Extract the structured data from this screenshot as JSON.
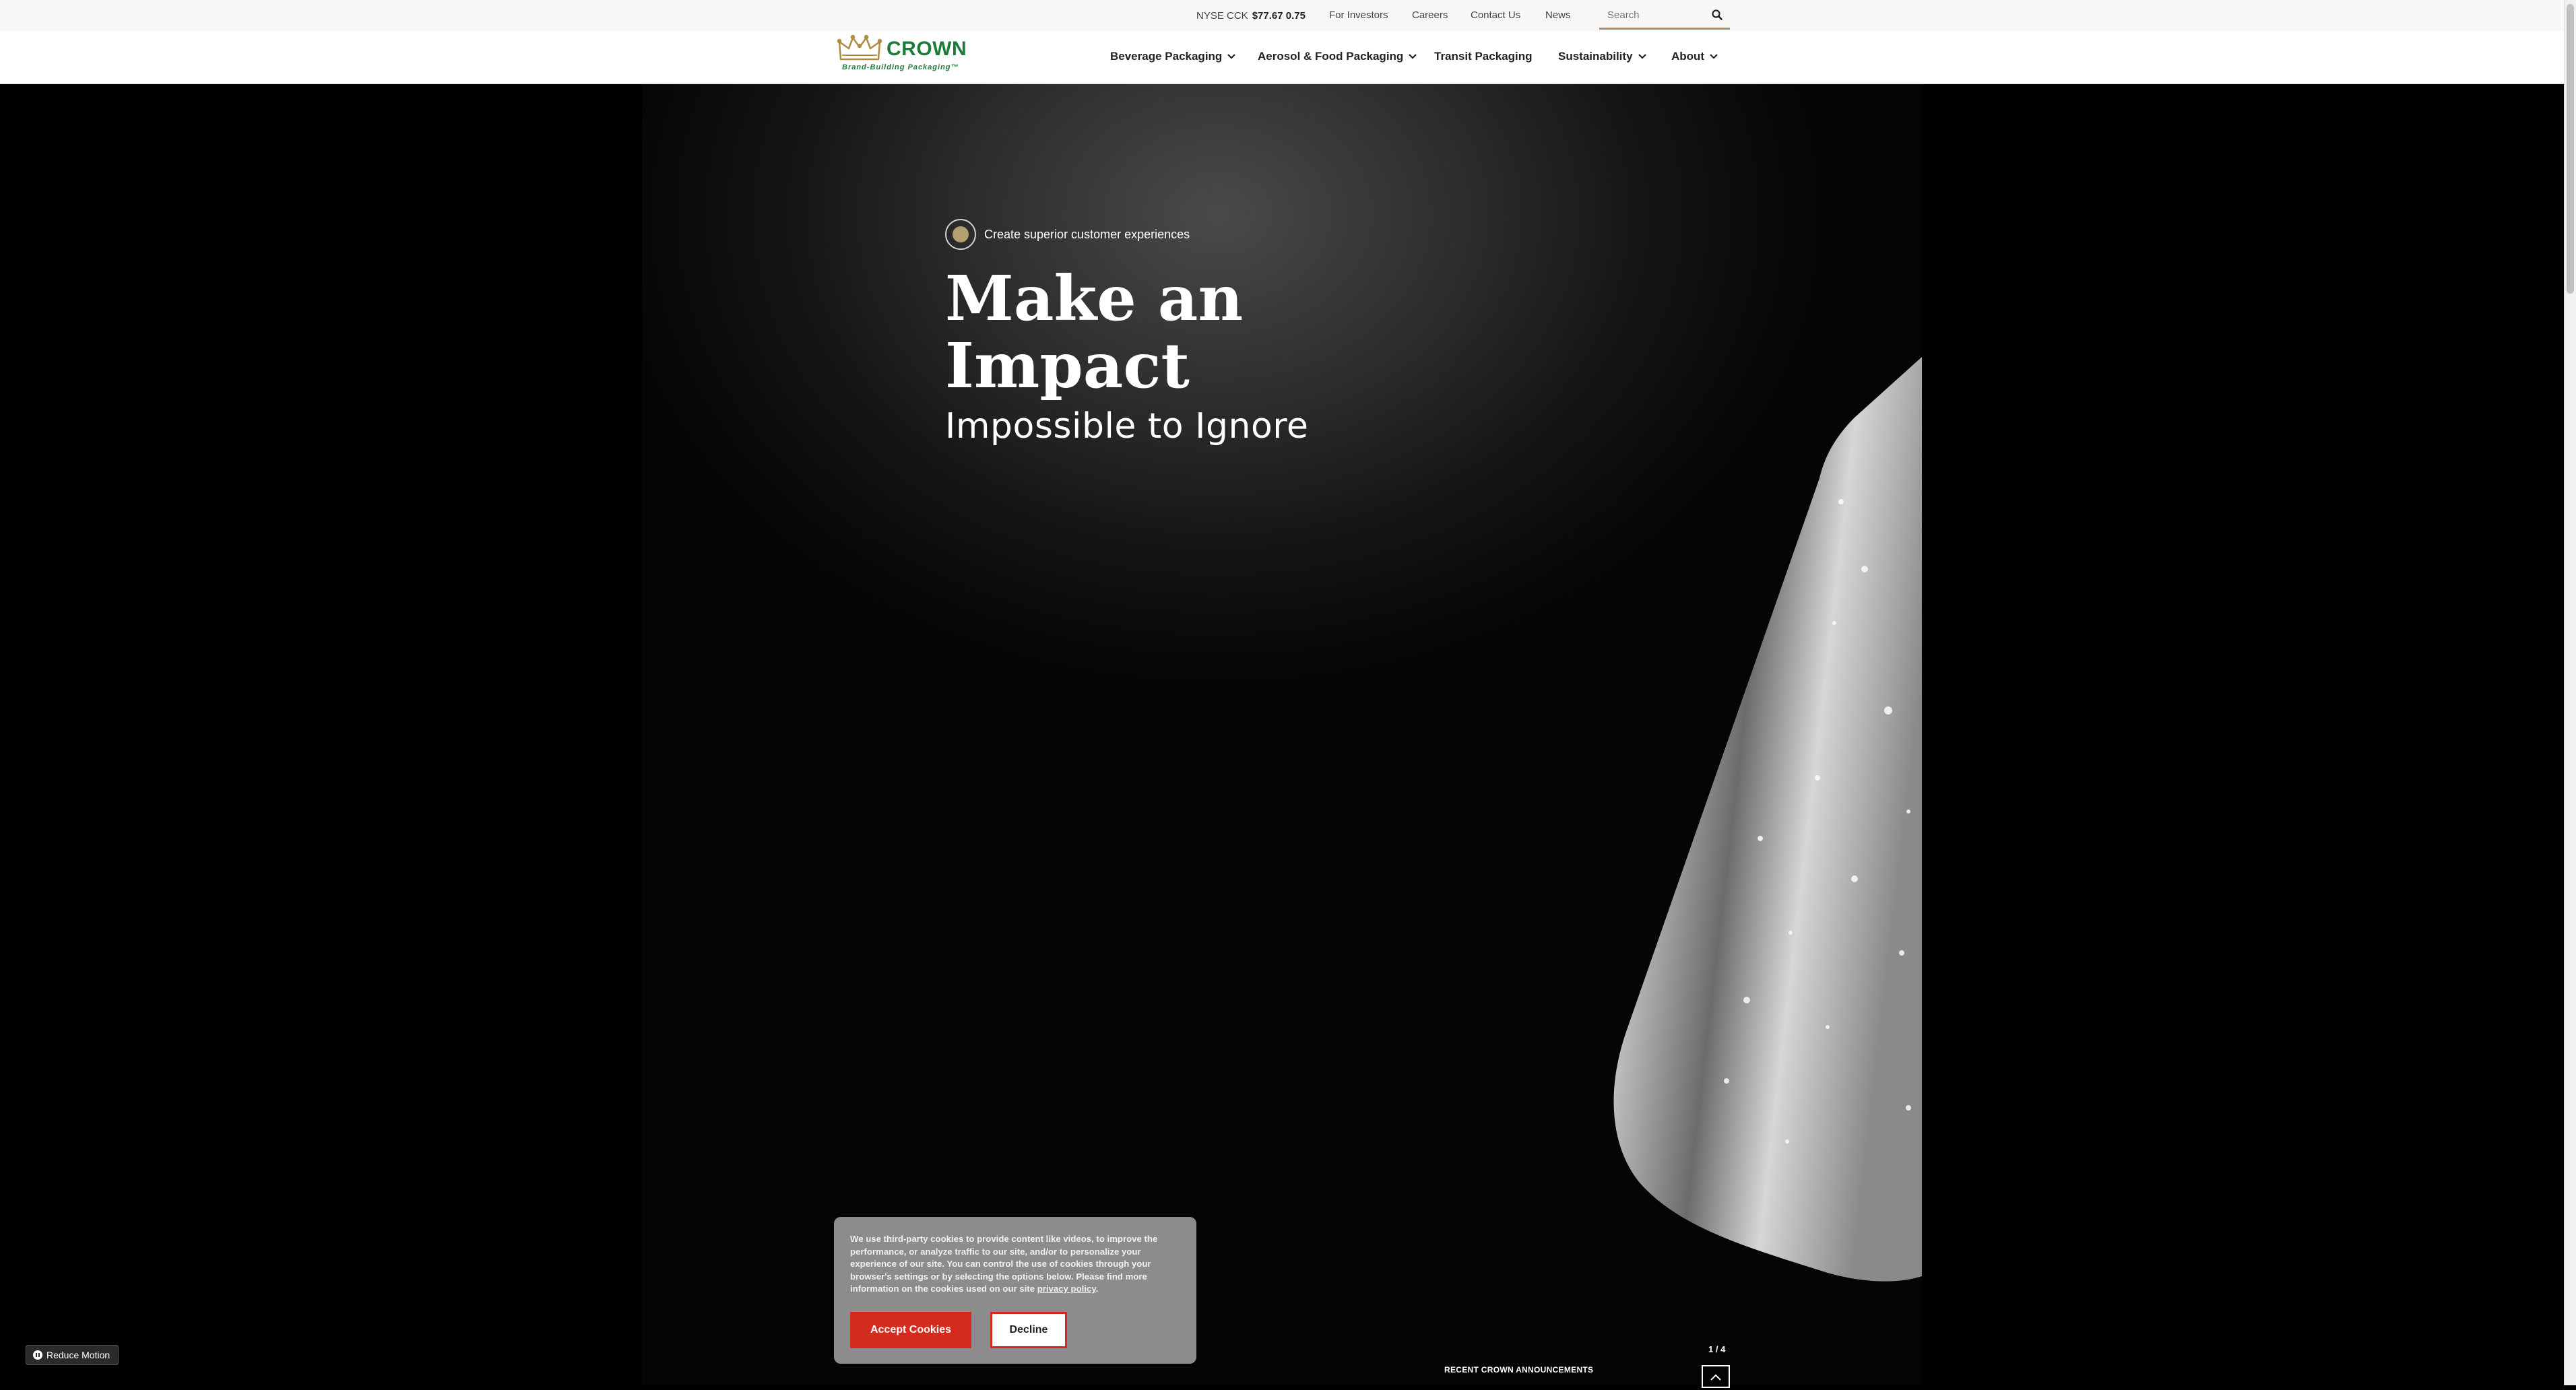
{
  "utility": {
    "stock_label": "NYSE CCK",
    "stock_price": "$77.67 0.75",
    "links": [
      "For Investors",
      "Careers",
      "Contact Us",
      "News"
    ],
    "search_placeholder": "Search"
  },
  "brand": {
    "name": "CROWN",
    "tagline": "Brand-Building Packaging™",
    "color": "#1e7b3a"
  },
  "nav": {
    "items": [
      {
        "label": "Beverage Packaging",
        "has_dropdown": true
      },
      {
        "label": "Aerosol & Food Packaging",
        "has_dropdown": true
      },
      {
        "label": "Transit Packaging",
        "has_dropdown": false
      },
      {
        "label": "Sustainability",
        "has_dropdown": true
      },
      {
        "label": "About",
        "has_dropdown": true
      }
    ]
  },
  "hero": {
    "eyebrow": "Create superior customer experiences",
    "headline": "Make an Impact",
    "subheadline": "Impossible to Ignore"
  },
  "cookie": {
    "text": "We use third-party cookies to provide content like videos, to improve the performance, or analyze traffic to our site, and/or to personalize your experience of our site. You can control the use of cookies through your browser's settings or by selecting the options below. Please find more information on the cookies used on our site ",
    "link_text": "privacy policy",
    "text_end": ".",
    "accept_label": "Accept Cookies",
    "decline_label": "Decline",
    "accent_color": "#d52b1e"
  },
  "reduce_motion_label": "Reduce Motion",
  "announcements": {
    "counter": "1 / 4",
    "title": "RECENT CROWN ANNOUNCEMENTS"
  }
}
